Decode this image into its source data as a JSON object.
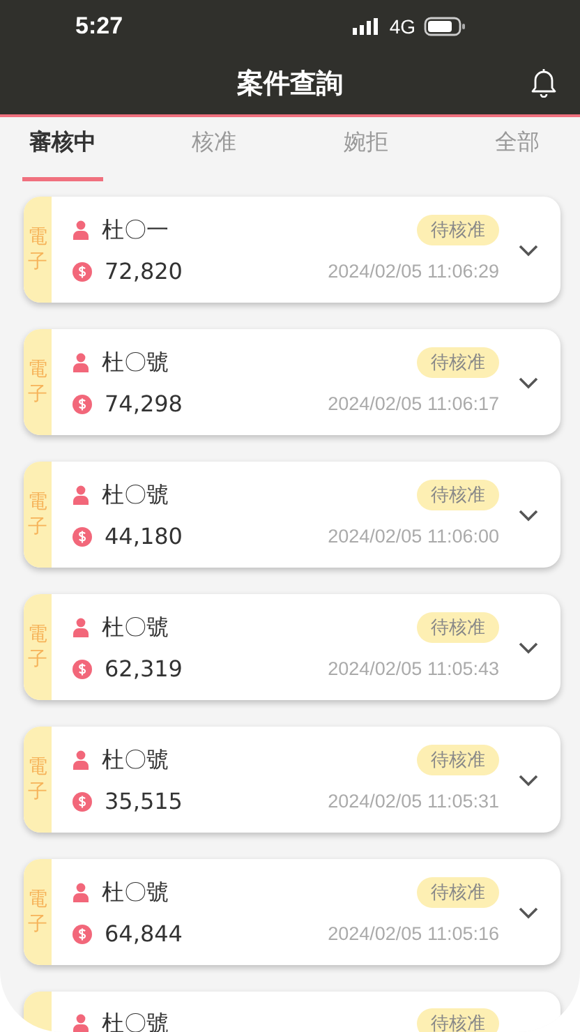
{
  "status_bar": {
    "time": "5:27",
    "network": "4G"
  },
  "header": {
    "title": "案件查詢"
  },
  "tabs": [
    {
      "label": "審核中",
      "selected": true
    },
    {
      "label": "核准",
      "selected": false
    },
    {
      "label": "婉拒",
      "selected": false
    },
    {
      "label": "全部",
      "selected": false
    }
  ],
  "cases": [
    {
      "type": "電子",
      "name": "杜〇一",
      "status": "待核准",
      "amount": "72,820",
      "time": "2024/02/05 11:06:29"
    },
    {
      "type": "電子",
      "name": "杜〇號",
      "status": "待核准",
      "amount": "74,298",
      "time": "2024/02/05 11:06:17"
    },
    {
      "type": "電子",
      "name": "杜〇號",
      "status": "待核准",
      "amount": "44,180",
      "time": "2024/02/05 11:06:00"
    },
    {
      "type": "電子",
      "name": "杜〇號",
      "status": "待核准",
      "amount": "62,319",
      "time": "2024/02/05 11:05:43"
    },
    {
      "type": "電子",
      "name": "杜〇號",
      "status": "待核准",
      "amount": "35,515",
      "time": "2024/02/05 11:05:31"
    },
    {
      "type": "電子",
      "name": "杜〇號",
      "status": "待核准",
      "amount": "64,844",
      "time": "2024/02/05 11:05:16"
    },
    {
      "name": "杜〇號",
      "status": "待核准"
    }
  ]
}
